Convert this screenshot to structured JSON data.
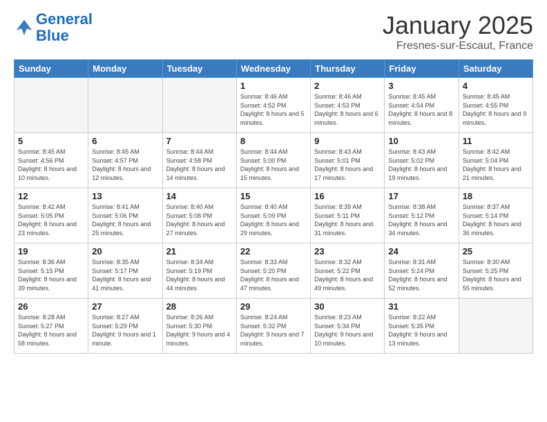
{
  "header": {
    "logo_line1": "General",
    "logo_line2": "Blue",
    "month_year": "January 2025",
    "location": "Fresnes-sur-Escaut, France"
  },
  "weekdays": [
    "Sunday",
    "Monday",
    "Tuesday",
    "Wednesday",
    "Thursday",
    "Friday",
    "Saturday"
  ],
  "weeks": [
    [
      {
        "day": "",
        "info": ""
      },
      {
        "day": "",
        "info": ""
      },
      {
        "day": "",
        "info": ""
      },
      {
        "day": "1",
        "info": "Sunrise: 8:46 AM\nSunset: 4:52 PM\nDaylight: 8 hours\nand 5 minutes."
      },
      {
        "day": "2",
        "info": "Sunrise: 8:46 AM\nSunset: 4:53 PM\nDaylight: 8 hours\nand 6 minutes."
      },
      {
        "day": "3",
        "info": "Sunrise: 8:45 AM\nSunset: 4:54 PM\nDaylight: 8 hours\nand 8 minutes."
      },
      {
        "day": "4",
        "info": "Sunrise: 8:45 AM\nSunset: 4:55 PM\nDaylight: 8 hours\nand 9 minutes."
      }
    ],
    [
      {
        "day": "5",
        "info": "Sunrise: 8:45 AM\nSunset: 4:56 PM\nDaylight: 8 hours\nand 10 minutes."
      },
      {
        "day": "6",
        "info": "Sunrise: 8:45 AM\nSunset: 4:57 PM\nDaylight: 8 hours\nand 12 minutes."
      },
      {
        "day": "7",
        "info": "Sunrise: 8:44 AM\nSunset: 4:58 PM\nDaylight: 8 hours\nand 14 minutes."
      },
      {
        "day": "8",
        "info": "Sunrise: 8:44 AM\nSunset: 5:00 PM\nDaylight: 8 hours\nand 15 minutes."
      },
      {
        "day": "9",
        "info": "Sunrise: 8:43 AM\nSunset: 5:01 PM\nDaylight: 8 hours\nand 17 minutes."
      },
      {
        "day": "10",
        "info": "Sunrise: 8:43 AM\nSunset: 5:02 PM\nDaylight: 8 hours\nand 19 minutes."
      },
      {
        "day": "11",
        "info": "Sunrise: 8:42 AM\nSunset: 5:04 PM\nDaylight: 8 hours\nand 21 minutes."
      }
    ],
    [
      {
        "day": "12",
        "info": "Sunrise: 8:42 AM\nSunset: 5:05 PM\nDaylight: 8 hours\nand 23 minutes."
      },
      {
        "day": "13",
        "info": "Sunrise: 8:41 AM\nSunset: 5:06 PM\nDaylight: 8 hours\nand 25 minutes."
      },
      {
        "day": "14",
        "info": "Sunrise: 8:40 AM\nSunset: 5:08 PM\nDaylight: 8 hours\nand 27 minutes."
      },
      {
        "day": "15",
        "info": "Sunrise: 8:40 AM\nSunset: 5:09 PM\nDaylight: 8 hours\nand 29 minutes."
      },
      {
        "day": "16",
        "info": "Sunrise: 8:39 AM\nSunset: 5:11 PM\nDaylight: 8 hours\nand 31 minutes."
      },
      {
        "day": "17",
        "info": "Sunrise: 8:38 AM\nSunset: 5:12 PM\nDaylight: 8 hours\nand 34 minutes."
      },
      {
        "day": "18",
        "info": "Sunrise: 8:37 AM\nSunset: 5:14 PM\nDaylight: 8 hours\nand 36 minutes."
      }
    ],
    [
      {
        "day": "19",
        "info": "Sunrise: 8:36 AM\nSunset: 5:15 PM\nDaylight: 8 hours\nand 39 minutes."
      },
      {
        "day": "20",
        "info": "Sunrise: 8:35 AM\nSunset: 5:17 PM\nDaylight: 8 hours\nand 41 minutes."
      },
      {
        "day": "21",
        "info": "Sunrise: 8:34 AM\nSunset: 5:19 PM\nDaylight: 8 hours\nand 44 minutes."
      },
      {
        "day": "22",
        "info": "Sunrise: 8:33 AM\nSunset: 5:20 PM\nDaylight: 8 hours\nand 47 minutes."
      },
      {
        "day": "23",
        "info": "Sunrise: 8:32 AM\nSunset: 5:22 PM\nDaylight: 8 hours\nand 49 minutes."
      },
      {
        "day": "24",
        "info": "Sunrise: 8:31 AM\nSunset: 5:24 PM\nDaylight: 8 hours\nand 52 minutes."
      },
      {
        "day": "25",
        "info": "Sunrise: 8:30 AM\nSunset: 5:25 PM\nDaylight: 8 hours\nand 55 minutes."
      }
    ],
    [
      {
        "day": "26",
        "info": "Sunrise: 8:28 AM\nSunset: 5:27 PM\nDaylight: 8 hours\nand 58 minutes."
      },
      {
        "day": "27",
        "info": "Sunrise: 8:27 AM\nSunset: 5:29 PM\nDaylight: 9 hours\nand 1 minute."
      },
      {
        "day": "28",
        "info": "Sunrise: 8:26 AM\nSunset: 5:30 PM\nDaylight: 9 hours\nand 4 minutes."
      },
      {
        "day": "29",
        "info": "Sunrise: 8:24 AM\nSunset: 5:32 PM\nDaylight: 9 hours\nand 7 minutes."
      },
      {
        "day": "30",
        "info": "Sunrise: 8:23 AM\nSunset: 5:34 PM\nDaylight: 9 hours\nand 10 minutes."
      },
      {
        "day": "31",
        "info": "Sunrise: 8:22 AM\nSunset: 5:35 PM\nDaylight: 9 hours\nand 13 minutes."
      },
      {
        "day": "",
        "info": ""
      }
    ]
  ]
}
